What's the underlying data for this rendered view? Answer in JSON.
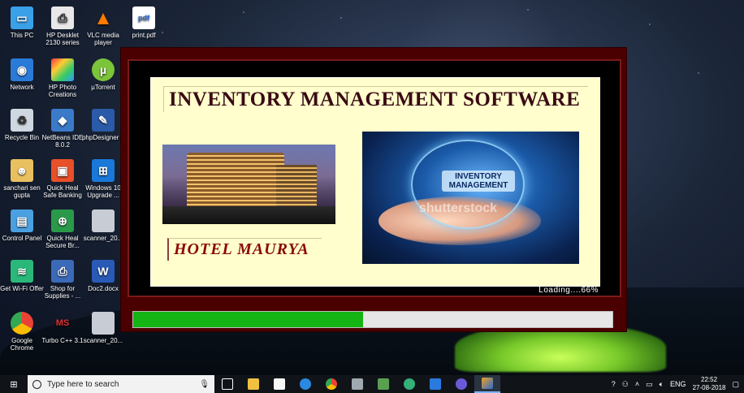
{
  "desktop": {
    "icons": [
      {
        "label": "This PC",
        "icon": "this-pc-icon"
      },
      {
        "label": "HP Desklet 2130 series",
        "icon": "printer-icon"
      },
      {
        "label": "VLC media player",
        "icon": "vlc-icon"
      },
      {
        "label": "print.pdf",
        "icon": "pdf-icon"
      },
      {
        "label": "Network",
        "icon": "network-icon"
      },
      {
        "label": "HP Photo Creations",
        "icon": "photo-icon"
      },
      {
        "label": "µTorrent",
        "icon": "utorrent-icon"
      },
      {
        "label": "Recycle Bin",
        "icon": "recycle-bin-icon"
      },
      {
        "label": "NetBeans IDE 8.0.2",
        "icon": "netbeans-icon"
      },
      {
        "label": "phpDesigner 8",
        "icon": "phpdesigner-icon"
      },
      {
        "label": "sanchari sen gupta",
        "icon": "user-folder-icon"
      },
      {
        "label": "Quick Heal Safe Banking",
        "icon": "quickheal-banking-icon"
      },
      {
        "label": "Windows 10 Upgrade ...",
        "icon": "windows-upgrade-icon"
      },
      {
        "label": "Control Panel",
        "icon": "control-panel-icon"
      },
      {
        "label": "Quick Heal Secure Br...",
        "icon": "quickheal-browser-icon"
      },
      {
        "label": "scanner_20...",
        "icon": "scan-file-icon"
      },
      {
        "label": "Get Wi-Fi Offer",
        "icon": "wifi-offer-icon"
      },
      {
        "label": "Shop for Supplies - ...",
        "icon": "shop-icon"
      },
      {
        "label": "Doc2.docx",
        "icon": "word-icon"
      },
      {
        "label": "Google Chrome",
        "icon": "chrome-icon"
      },
      {
        "label": "Turbo C++ 3.1",
        "icon": "turbo-cpp-icon"
      },
      {
        "label": "scanner_20...",
        "icon": "scan-file-icon"
      }
    ]
  },
  "splash": {
    "title": "INVENTORY MANAGEMENT SOFTWARE",
    "hotel_name": "HOTEL MAURYA",
    "image_label": "INVENTORY MANAGEMENT",
    "watermark": "shutterstock",
    "loading_text": "Loading....66%",
    "progress": 0.48
  },
  "taskbar": {
    "search_placeholder": "Type here to search",
    "language": "ENG",
    "time": "22:52",
    "date": "27-08-2018"
  },
  "colors": {
    "splash_border": "#4a0000",
    "panel_bg": "#fffecc",
    "title_text": "#3a0a14",
    "hotel_text": "#8a0a0a",
    "progress_fill": "#14b414"
  }
}
